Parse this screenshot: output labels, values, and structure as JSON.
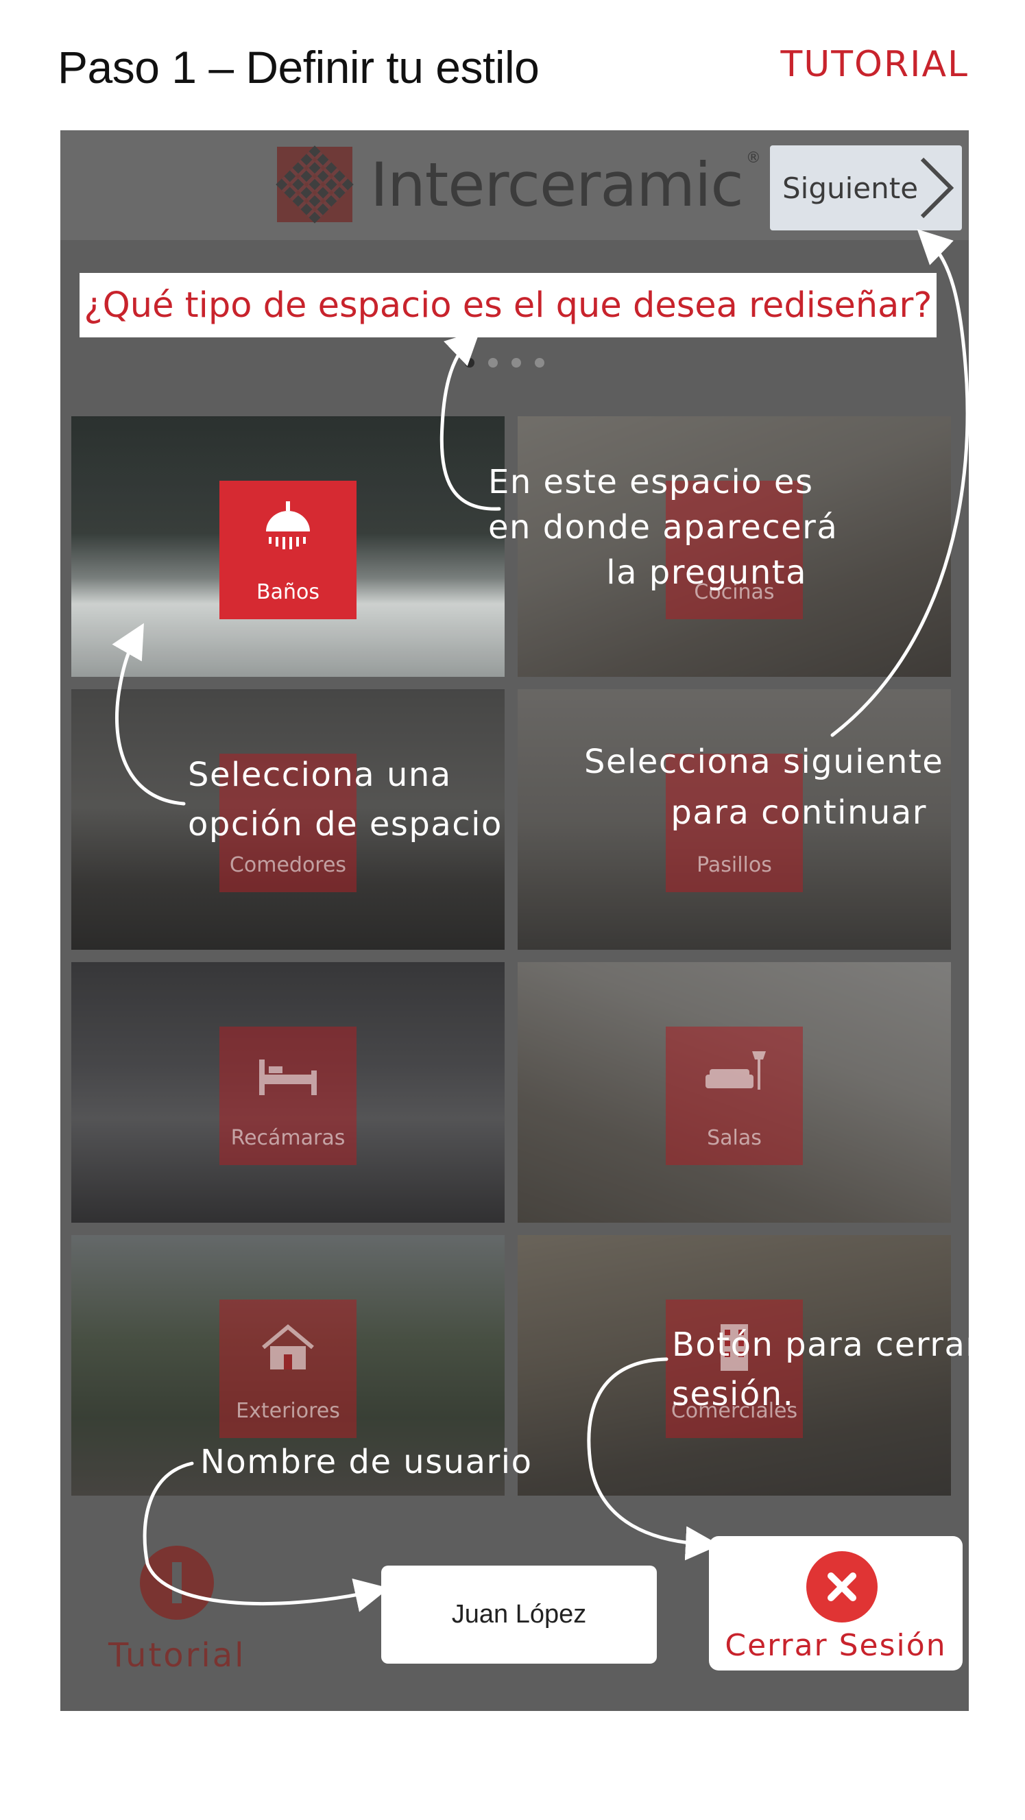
{
  "page": {
    "heading": "Paso 1 – Definir tu estilo",
    "tutorial_title": "TUTORIAL"
  },
  "app": {
    "brand": "Interceramic",
    "brand_mark": "®",
    "next_label": "Siguiente",
    "question": "¿Qué tipo de espacio es el que desea rediseñar?",
    "pager": {
      "pages": 4,
      "current": 1
    },
    "tiles": [
      {
        "label": "Baños",
        "icon": "shower-icon",
        "selected": true
      },
      {
        "label": "Cocinas",
        "icon": "kitchen-icon",
        "selected": false
      },
      {
        "label": "Comedores",
        "icon": "dining-icon",
        "selected": false
      },
      {
        "label": "Pasillos",
        "icon": "hallway-icon",
        "selected": false
      },
      {
        "label": "Recámaras",
        "icon": "bed-icon",
        "selected": false
      },
      {
        "label": "Salas",
        "icon": "sofa-icon",
        "selected": false
      },
      {
        "label": "Exteriores",
        "icon": "house-icon",
        "selected": false
      },
      {
        "label": "Comerciales",
        "icon": "building-icon",
        "selected": false
      }
    ],
    "tutorial_label": "Tutorial",
    "user_name": "Juan López",
    "logout_label": "Cerrar Sesión"
  },
  "annotations": {
    "question_note": [
      "En este espacio es",
      "en donde aparecerá",
      "la pregunta"
    ],
    "select_note": [
      "Selecciona una",
      "opción de espacio"
    ],
    "next_note": [
      "Selecciona siguiente",
      "para continuar"
    ],
    "logout_note": [
      "Botón para cerrar",
      "sesión."
    ],
    "user_note": "Nombre de usuario"
  },
  "colors": {
    "accent": "#c8232c",
    "overlay": "#5e5e5e",
    "badge_red": "#d62a32"
  }
}
